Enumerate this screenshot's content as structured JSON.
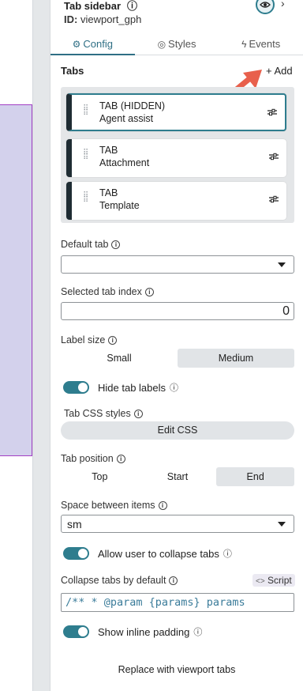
{
  "header": {
    "title": "Tab sidebar",
    "id_label": "ID:",
    "id_value": "viewport_gph"
  },
  "panel_tabs": [
    {
      "label": "Config",
      "icon": "gear-icon"
    },
    {
      "label": "Styles",
      "icon": "palette-icon"
    },
    {
      "label": "Events",
      "icon": "bolt-icon"
    }
  ],
  "tabs_section": {
    "title": "Tabs",
    "add_label": "+ Add",
    "items": [
      {
        "line1": "TAB (HIDDEN)",
        "line2": "Agent assist"
      },
      {
        "line1": "TAB",
        "line2": "Attachment"
      },
      {
        "line1": "TAB",
        "line2": "Template"
      }
    ]
  },
  "default_tab": {
    "label": "Default tab",
    "value": ""
  },
  "selected_index": {
    "label": "Selected tab index",
    "value": "0"
  },
  "label_size": {
    "label": "Label size",
    "options": [
      "Small",
      "Medium"
    ],
    "selected": "Medium"
  },
  "hide_labels": {
    "label": "Hide tab labels",
    "on": true
  },
  "css": {
    "label": "Tab CSS styles",
    "button": "Edit CSS"
  },
  "tab_position": {
    "label": "Tab position",
    "options": [
      "Top",
      "Start",
      "End"
    ],
    "selected": "End"
  },
  "spacing": {
    "label": "Space between items",
    "value": "sm"
  },
  "collapse_allow": {
    "label": "Allow user to collapse tabs",
    "on": true
  },
  "collapse_default": {
    "label": "Collapse tabs by default",
    "script_label": "Script",
    "code": "/**  * @param {params} params"
  },
  "inline_padding": {
    "label": "Show inline padding",
    "on": true
  },
  "replace_label": "Replace with viewport tabs",
  "colors": {
    "accent": "#2e7d8e",
    "selection": "#a23fc4",
    "arrow": "#e8604c"
  }
}
